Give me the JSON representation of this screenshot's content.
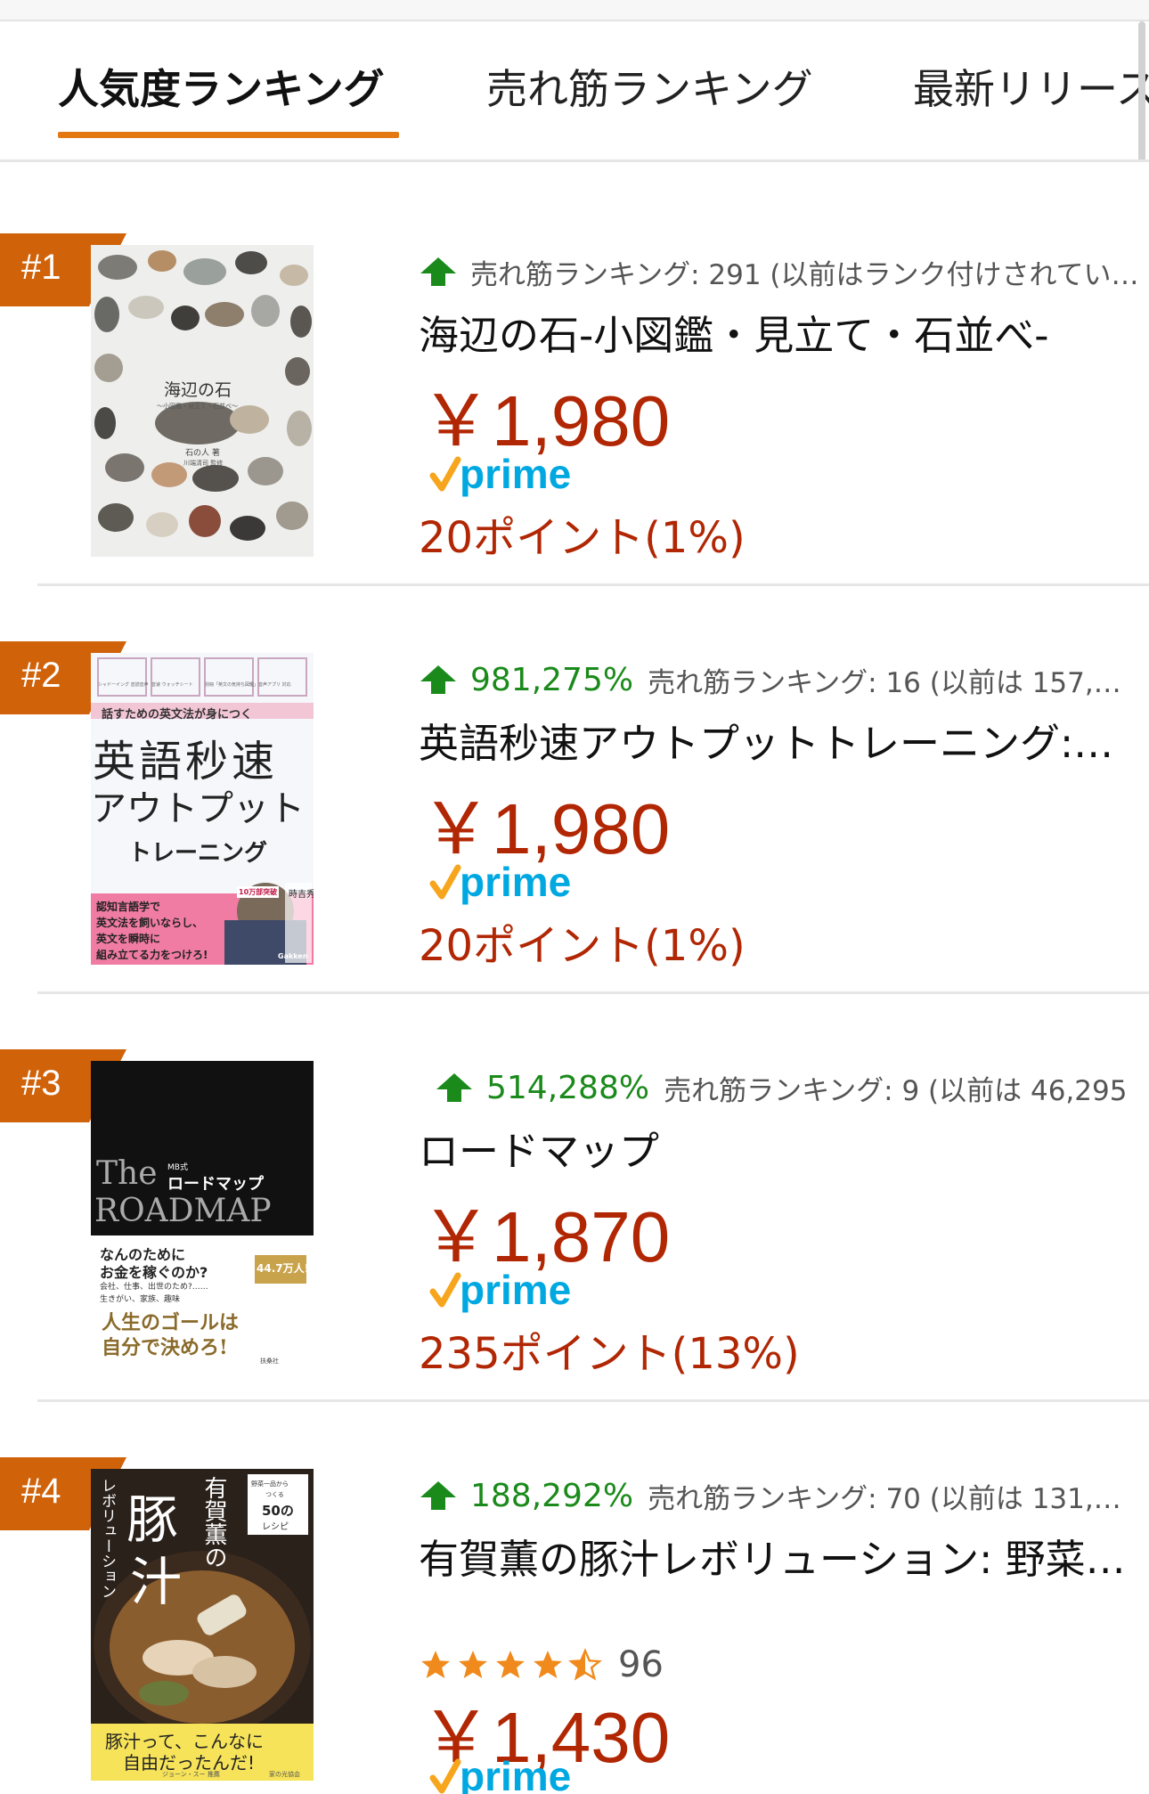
{
  "tabs": [
    {
      "label": "人気度ランキング",
      "active": true
    },
    {
      "label": "売れ筋ランキング",
      "active": false
    },
    {
      "label": "最新リリース",
      "active": false
    }
  ],
  "colors": {
    "accent": "#e47911",
    "price": "#b12704",
    "up": "#1a8a1a",
    "prime": "#00a8e1"
  },
  "items": [
    {
      "rank": "#1",
      "movement": "",
      "rank_text": "売れ筋ランキング: 291 (以前はランク付けされてい…",
      "title": "海辺の石-小図鑑・見立て・石並べ-",
      "price": "￥1,980",
      "prime": "prime",
      "points": "20ポイント(1%)",
      "cover": {
        "title": "海辺の石",
        "subtitle": "〜小図鑑・見立て・石並べ〜",
        "author": "石の人 著",
        "supervisor": "川端清司 監修"
      }
    },
    {
      "rank": "#2",
      "movement": "981,275%",
      "rank_text": "売れ筋ランキング: 16 (以前は 157,…",
      "title": "英語秒速アウトプットトレーニング:…",
      "price": "￥1,980",
      "prime": "prime",
      "points": "20ポイント(1%)",
      "cover": {
        "tagline": "話すための英文法が身につく",
        "line1": "英語秒速",
        "line2": "アウトプット",
        "line3": "トレーニング",
        "pink1": "認知言語学で",
        "pink2": "英文法を飼いならし、",
        "pink3": "英文を瞬時に",
        "pink4": "組み立てる力をつけろ!",
        "author": "時吉秀弥",
        "badge": "10万部突破",
        "icon1": "シャドーイング 音読音声",
        "icon2": "音速 ウォッチシート",
        "icon3": "別冊「英文の気持ち図鑑」",
        "icon4": "音声アプリ 対応",
        "publisher": "Gakken"
      }
    },
    {
      "rank": "#3",
      "movement": "514,288%",
      "rank_text": "売れ筋ランキング: 9 (以前は 46,295",
      "title": "ロードマップ",
      "price": "￥1,870",
      "prime": "prime",
      "points": "235ポイント(13%)",
      "cover": {
        "the": "The",
        "mb": "MB式",
        "jp": "ロードマップ",
        "roadmap": "ROADMAP",
        "q1": "なんのために",
        "q2": "お金を稼ぐのか?",
        "sub1": "会社、仕事、出世のため?……",
        "sub2": "生きがい、家族、趣味",
        "goal1": "人生のゴールは",
        "goal2": "自分で決めろ!",
        "count": "44.7万人!",
        "publisher": "扶桑社"
      }
    },
    {
      "rank": "#4",
      "movement": "188,292%",
      "rank_text": "売れ筋ランキング: 70 (以前は 131,…",
      "title": "有賀薫の豚汁レボリューション: 野菜…",
      "rating": 4.5,
      "reviews": "96",
      "price": "￥1,430",
      "prime": "prime",
      "cover": {
        "name": "有賀薫の",
        "main1": "豚",
        "main2": "汁",
        "rev": "レボリューション",
        "corner1": "野菜一品から",
        "corner2": "つくる",
        "corner3": "50の",
        "corner4": "レシピ",
        "yellow1": "豚汁って、こんなに",
        "yellow2": "自由だったんだ!",
        "credit": "ジョーン・スー 推薦",
        "publisher": "家の光協会"
      }
    }
  ]
}
